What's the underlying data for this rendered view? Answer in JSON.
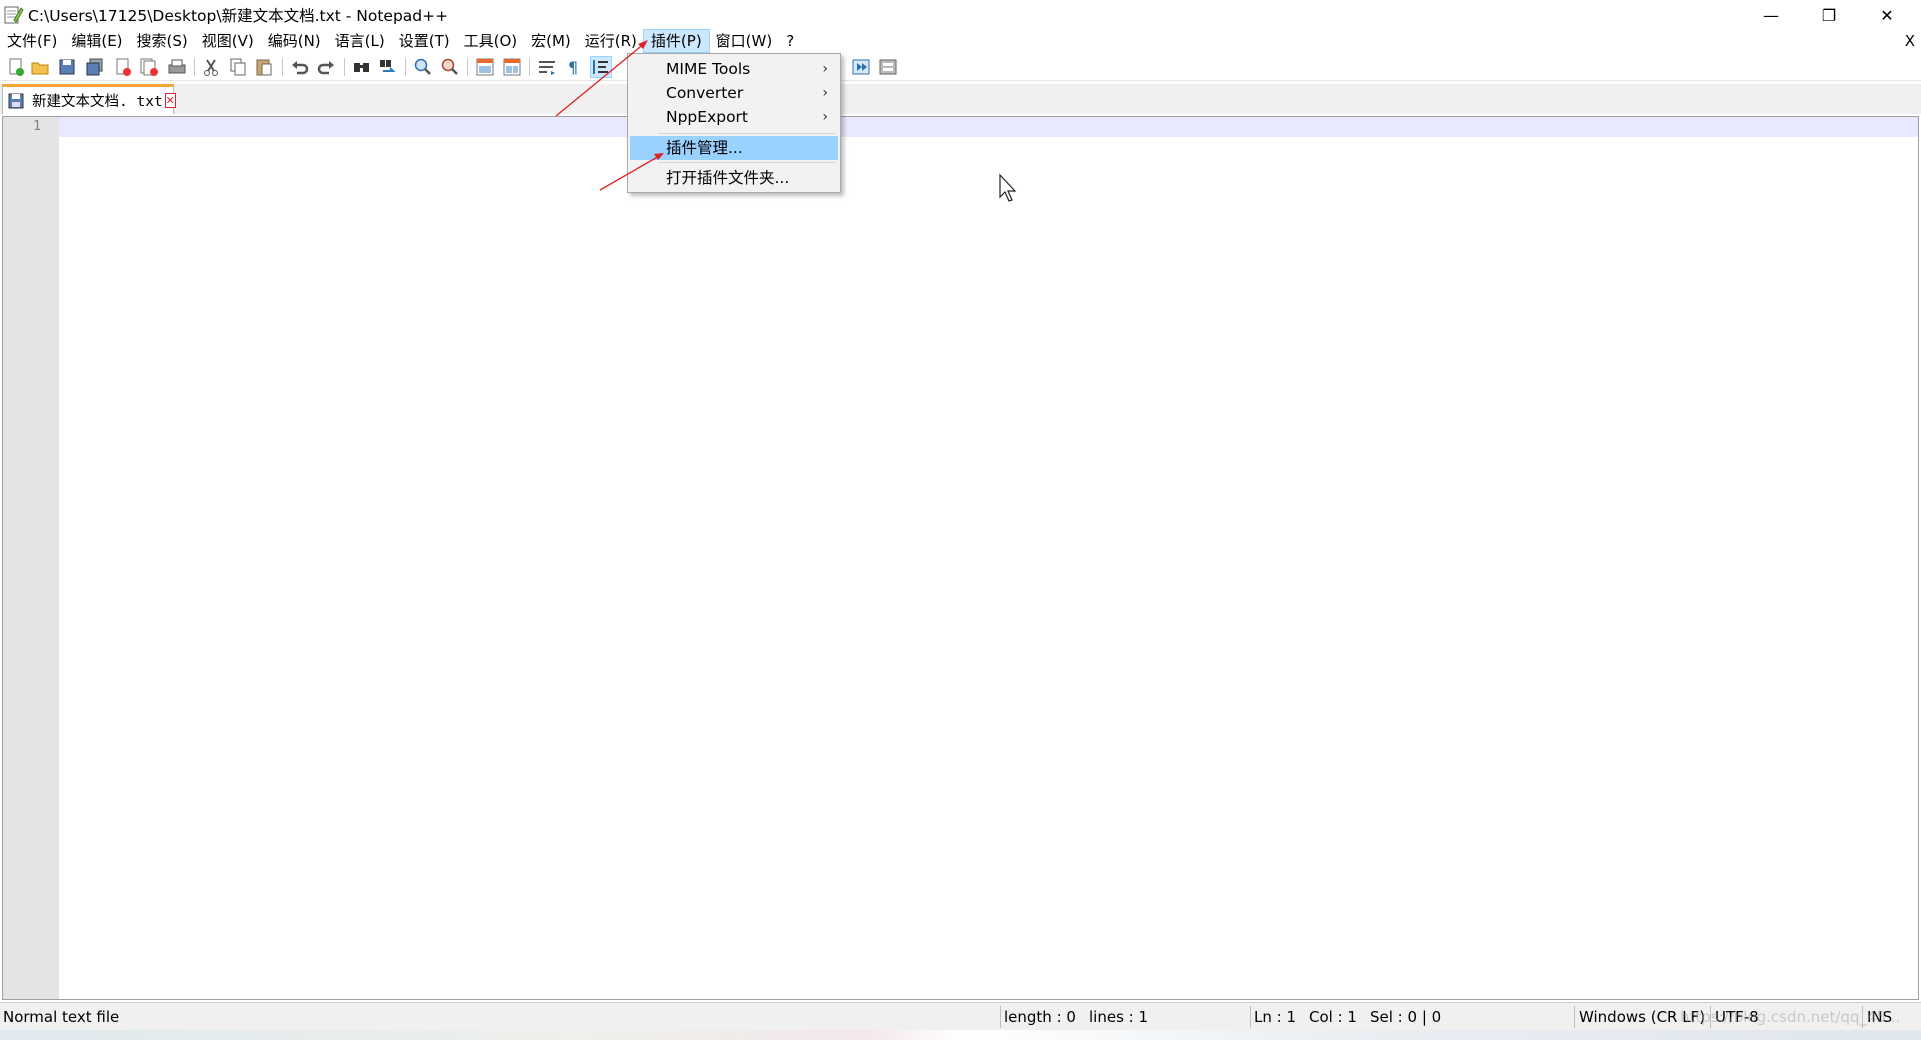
{
  "window": {
    "title": "C:\\Users\\17125\\Desktop\\新建文本文档.txt - Notepad++",
    "minimize_glyph": "—",
    "maximize_glyph": "❐",
    "close_glyph": "✕"
  },
  "menubar": {
    "items": [
      "文件(F)",
      "编辑(E)",
      "搜索(S)",
      "视图(V)",
      "编码(N)",
      "语言(L)",
      "设置(T)",
      "工具(O)",
      "宏(M)",
      "运行(R)",
      "插件(P)",
      "窗口(W)",
      "?"
    ],
    "active_index": 10,
    "close_x": "X"
  },
  "toolbar": {
    "icons": [
      "new-file-icon",
      "open-file-icon",
      "save-icon",
      "save-all-icon",
      "close-icon",
      "close-all-icon",
      "print-icon",
      "cut-icon",
      "copy-icon",
      "paste-icon",
      "undo-icon",
      "redo-icon",
      "find-icon",
      "replace-icon",
      "zoom-in-icon",
      "zoom-out-icon",
      "sync-vertical-icon",
      "sync-horizontal-icon",
      "word-wrap-icon",
      "show-all-chars-icon",
      "indent-guide-icon",
      "macro-run-multiple-icon",
      "macro-save-icon"
    ]
  },
  "tab": {
    "label": "新建文本文档. txt",
    "close_glyph": "✕"
  },
  "editor": {
    "line_number": "1"
  },
  "plugins_menu": {
    "items": [
      {
        "label": "MIME Tools",
        "submenu": true
      },
      {
        "label": "Converter",
        "submenu": true
      },
      {
        "label": "NppExport",
        "submenu": true
      },
      {
        "label": "插件管理...",
        "submenu": false,
        "selected": true
      },
      {
        "label": "打开插件文件夹...",
        "submenu": false
      }
    ],
    "submenu_arrow": "›"
  },
  "statusbar": {
    "file_type": "Normal text file",
    "length": "length : 0",
    "lines": "lines : 1",
    "ln": "Ln : 1",
    "col": "Col : 1",
    "sel": "Sel : 0 | 0",
    "eol": "Windows (CR LF)",
    "encoding": "UTF-8",
    "mode": "INS"
  },
  "watermark": "https://blog.csdn.net/qq_45...",
  "colors": {
    "accent_tab": "#f7a53a",
    "menu_highlight": "#99d1ff",
    "annotation_arrow": "#e02020"
  }
}
